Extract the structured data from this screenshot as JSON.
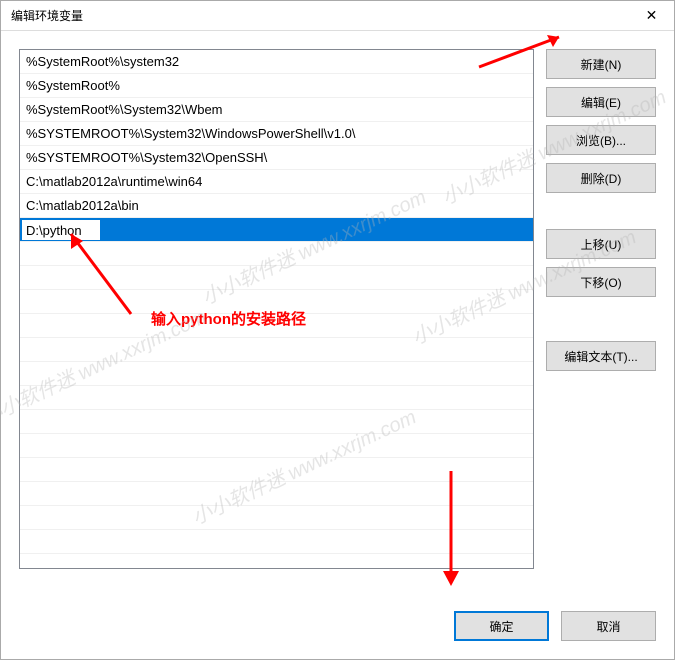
{
  "titlebar": {
    "title": "编辑环境变量"
  },
  "list": {
    "items": [
      "%SystemRoot%\\system32",
      "%SystemRoot%",
      "%SystemRoot%\\System32\\Wbem",
      "%SYSTEMROOT%\\System32\\WindowsPowerShell\\v1.0\\",
      "%SYSTEMROOT%\\System32\\OpenSSH\\",
      "C:\\matlab2012a\\runtime\\win64",
      "C:\\matlab2012a\\bin"
    ],
    "editing_value": "D:\\python"
  },
  "buttons": {
    "new": "新建(N)",
    "edit": "编辑(E)",
    "browse": "浏览(B)...",
    "delete": "删除(D)",
    "move_up": "上移(U)",
    "move_down": "下移(O)",
    "edit_text": "编辑文本(T)..."
  },
  "footer": {
    "ok": "确定",
    "cancel": "取消"
  },
  "annotation": {
    "text": "输入python的安装路径"
  },
  "watermark": "小小软件迷 www.xxrjm.com"
}
